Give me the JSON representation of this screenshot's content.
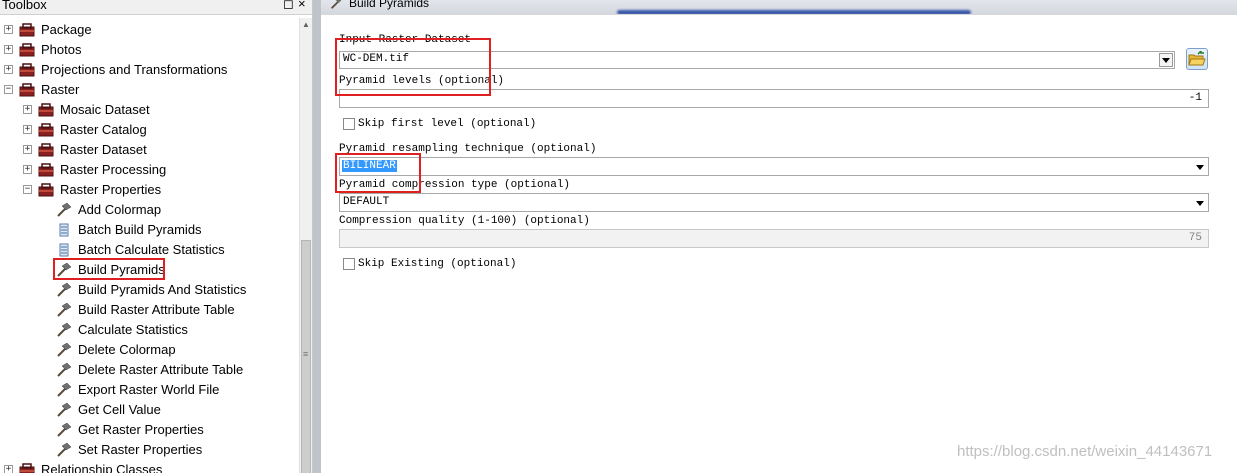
{
  "toolbox": {
    "title": "Toolbox",
    "pin_glyph": "◻",
    "close_glyph": "×",
    "items": [
      {
        "label": "Package",
        "expander": "+",
        "kind": "toolbox",
        "level": 0
      },
      {
        "label": "Photos",
        "expander": "+",
        "kind": "toolbox",
        "level": 0
      },
      {
        "label": "Projections and Transformations",
        "expander": "+",
        "kind": "toolbox",
        "level": 0
      },
      {
        "label": "Raster",
        "expander": "−",
        "kind": "toolbox",
        "level": 0
      },
      {
        "label": "Mosaic Dataset",
        "expander": "+",
        "kind": "toolbox",
        "level": 1
      },
      {
        "label": "Raster Catalog",
        "expander": "+",
        "kind": "toolbox",
        "level": 1
      },
      {
        "label": "Raster Dataset",
        "expander": "+",
        "kind": "toolbox",
        "level": 1
      },
      {
        "label": "Raster Processing",
        "expander": "+",
        "kind": "toolbox",
        "level": 1
      },
      {
        "label": "Raster Properties",
        "expander": "−",
        "kind": "toolbox",
        "level": 1
      },
      {
        "label": "Add Colormap",
        "kind": "tool",
        "level": 2
      },
      {
        "label": "Batch Build Pyramids",
        "kind": "script",
        "level": 2
      },
      {
        "label": "Batch Calculate Statistics",
        "kind": "script",
        "level": 2
      },
      {
        "label": "Build Pyramids",
        "kind": "tool",
        "level": 2,
        "highlighted": true
      },
      {
        "label": "Build Pyramids And Statistics",
        "kind": "tool",
        "level": 2
      },
      {
        "label": "Build Raster Attribute Table",
        "kind": "tool",
        "level": 2
      },
      {
        "label": "Calculate Statistics",
        "kind": "tool",
        "level": 2
      },
      {
        "label": "Delete Colormap",
        "kind": "tool",
        "level": 2
      },
      {
        "label": "Delete Raster Attribute Table",
        "kind": "tool",
        "level": 2
      },
      {
        "label": "Export Raster World File",
        "kind": "tool",
        "level": 2
      },
      {
        "label": "Get Cell Value",
        "kind": "tool",
        "level": 2
      },
      {
        "label": "Get Raster Properties",
        "kind": "tool",
        "level": 2
      },
      {
        "label": "Set Raster Properties",
        "kind": "tool",
        "level": 2
      },
      {
        "label": "Relationship Classes",
        "expander": "+",
        "kind": "toolbox",
        "level": 0
      }
    ]
  },
  "dialog": {
    "title": "Build Pyramids",
    "input_raster_label": "Input Raster Dataset",
    "input_raster_value": "WC-DEM.tif",
    "pyramid_levels_label": "Pyramid levels (optional)",
    "pyramid_levels_value": "-1",
    "skip_first_label": "Skip first level (optional)",
    "resampling_label": "Pyramid resampling technique (optional)",
    "resampling_value": "BILINEAR",
    "compression_type_label": "Pyramid compression type (optional)",
    "compression_type_value": "DEFAULT",
    "compression_quality_label": "Compression quality (1-100) (optional)",
    "compression_quality_value": "75",
    "skip_existing_label": "Skip Existing (optional)"
  },
  "watermark": "https://blog.csdn.net/weixin_44143671",
  "colors": {
    "highlight_box": "#e02020",
    "selection": "#3399ff",
    "toolbox_icon": "#8b2020"
  }
}
